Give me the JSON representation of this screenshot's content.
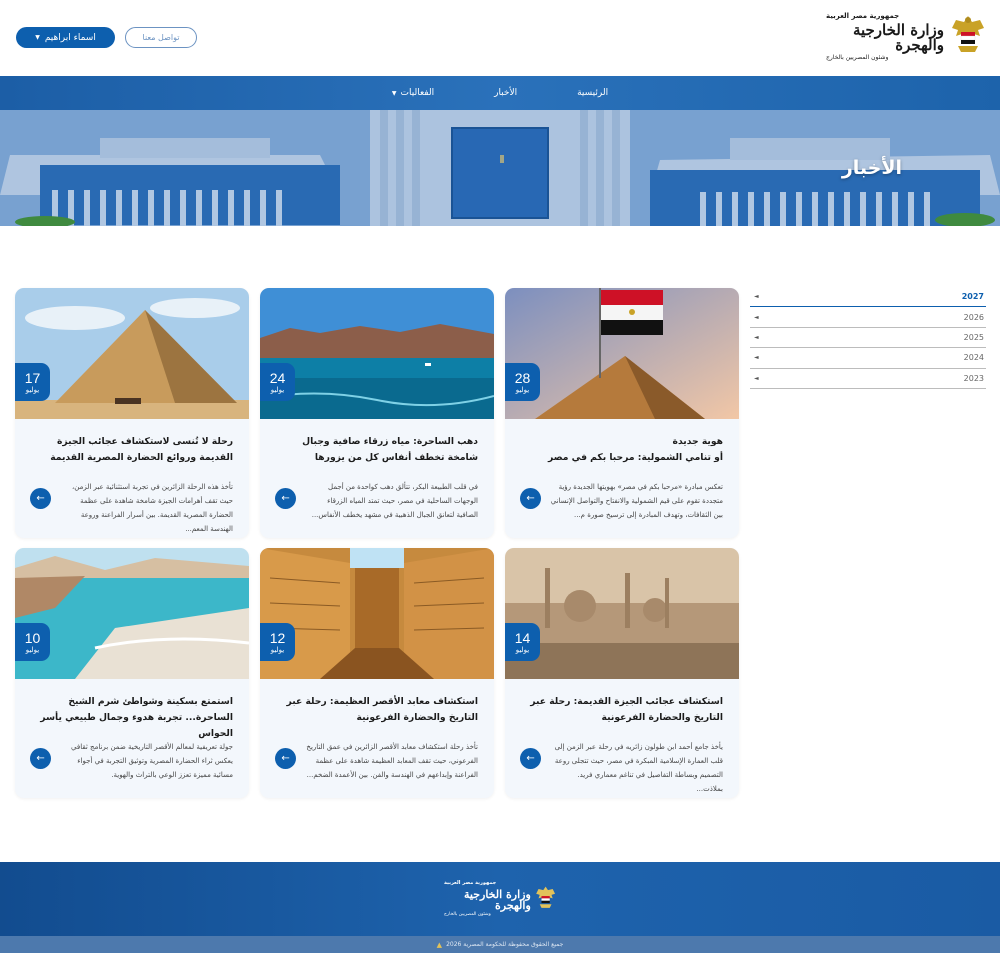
{
  "header": {
    "logo": {
      "line1": "جمهورية مصر العربية",
      "line2": "وزارة الخارجية والهجرة",
      "line3": "وشئون المصريين بالخارج"
    },
    "user_button": "اسماء ابراهيم",
    "contact_button": "تواصل معنا"
  },
  "nav": {
    "items": [
      {
        "label": "الرئيسية"
      },
      {
        "label": "الأخبار"
      },
      {
        "label": "الفعاليات"
      }
    ]
  },
  "hero": {
    "title": "الأخبار"
  },
  "years": {
    "items": [
      "2027",
      "2026",
      "2025",
      "2024",
      "2023"
    ],
    "active": "2027"
  },
  "cards": [
    {
      "day": "28",
      "month": "يوليو",
      "title": "هوية جديدة\nأو تنامي الشمولية: مرحبا بكم في مصر",
      "text": "تعكس مبادرة «مرحبا بكم في مصر» بهويتها الجديدة رؤية متجددة تقوم على قيم الشمولية والانفتاح والتواصل الإنساني بين الثقافات، وتهدف المبادرة إلى ترسيخ صورة م..."
    },
    {
      "day": "24",
      "month": "يوليو",
      "title": "دهب الساحرة: مياه زرقاء صافية وجبال شامخة تخطف أنفاس كل من يزورها",
      "text": "في قلب الطبيعة البكر، تتألق دهب كواحدة من أجمل الوجهات الساحلية في مصر، حيث تمتد المياه الزرقاء الصافية لتعانق الجبال الذهبية في مشهد يخطف الأنفاس..."
    },
    {
      "day": "17",
      "month": "يوليو",
      "title": "رحلة لا تُنسى لاستكشاف عجائب الجيزة القديمة وروائع الحضارة المصرية القديمة",
      "text": "تأخذ هذه الرحلة الزائرين في تجربة استثنائية عبر الزمن، حيث تقف أهرامات الجيزة شامخة شاهدة على عظمة الحضارة المصرية القديمة. بين أسرار الفراعنة وروعة الهندسة المعم..."
    },
    {
      "day": "14",
      "month": "يوليو",
      "title": "استكشاف عجائب الجيزة القديمة: رحلة عبر التاريخ والحضارة الفرعونية",
      "text": "يأخذ جامع أحمد ابن طولون زائريه في رحلة عبر الزمن إلى قلب العمارة الإسلامية المبكرة في مصر، حيث تتجلى روعة التصميم وبساطة التفاصيل في تناغم معماري فريد. بملاذت..."
    },
    {
      "day": "12",
      "month": "يوليو",
      "title": "استكشاف معابد الأقصر العظيمة: رحلة عبر التاريخ والحضارة الفرعونية",
      "text": "تأخذ رحلة استكشاف معابد الأقصر الزائرين في عمق التاريخ الفرعوني، حيث تقف المعابد العظيمة شاهدة على عظمة الفراعنة وإبداعهم في الهندسة والفن. بين الأعمدة الضخم..."
    },
    {
      "day": "10",
      "month": "يوليو",
      "title": "استمتع بسكينة وشواطئ شرم الشيخ الساحرة... تجربة هدوء وجمال طبيعي يأسر الحواس",
      "text": "جولة تعريفية لمعالم الأقصر التاريخية ضمن برنامج ثقافي يعكس ثراء الحضارة المصرية وتوثيق التجربة في أجواء مسائية مميزة تعزز الوعي بالتراث والهوية."
    }
  ],
  "footer": {
    "copyright": "جميع الحقوق محفوظة للحكومة المصرية 2026"
  },
  "colors": {
    "primary": "#0d5fae",
    "nav": "#2a71ba",
    "card_bg": "#f3f7fc"
  }
}
